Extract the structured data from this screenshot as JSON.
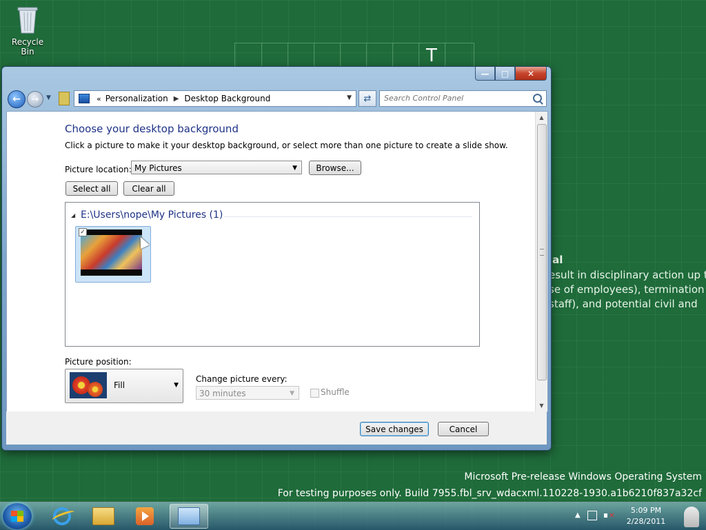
{
  "desktop": {
    "recycle_bin_label": "Recycle Bin",
    "background_text": {
      "line1": "ial",
      "line2": "esult in disciplinary action up to",
      "line3": "se of employees), termination of",
      "line4": "staff), and potential civil and",
      "wallpaper_letter": "T"
    },
    "watermark": {
      "line1": "Microsoft Pre-release Windows Operating System",
      "line2": "For testing purposes only. Build 7955.fbl_srv_wdacxml.110228-1930.a1b6210f837a32cf"
    }
  },
  "window": {
    "controls": {
      "minimize": "—",
      "maximize": "□",
      "close": "✕"
    },
    "address": {
      "chevron": "«",
      "crumbs": [
        "Personalization",
        "Desktop Background"
      ]
    },
    "search": {
      "placeholder": "Search Control Panel"
    },
    "heading": "Choose your desktop background",
    "description": "Click a picture to make it your desktop background, or select more than one picture to create a slide show.",
    "picture_location": {
      "label": "Picture location:",
      "value": "My Pictures",
      "browse_label": "Browse..."
    },
    "select_all_label": "Select all",
    "clear_all_label": "Clear all",
    "group": {
      "title": "E:\\Users\\nope\\My Pictures (1)",
      "items": [
        {
          "checked": true
        }
      ]
    },
    "picture_position": {
      "label": "Picture position:",
      "value": "Fill"
    },
    "change_every": {
      "label": "Change picture every:",
      "value": "30 minutes"
    },
    "shuffle_label": "Shuffle",
    "save_label": "Save changes",
    "cancel_label": "Cancel"
  },
  "taskbar": {
    "clock": {
      "time": "5:09 PM",
      "date": "2/28/2011"
    },
    "pinned": [
      "internet-explorer",
      "windows-explorer",
      "media-player",
      "control-panel"
    ],
    "active": "control-panel"
  },
  "colors": {
    "desktop_bg": "#1f6b3a",
    "heading": "#1e3287",
    "close_button": "#c7442b"
  }
}
